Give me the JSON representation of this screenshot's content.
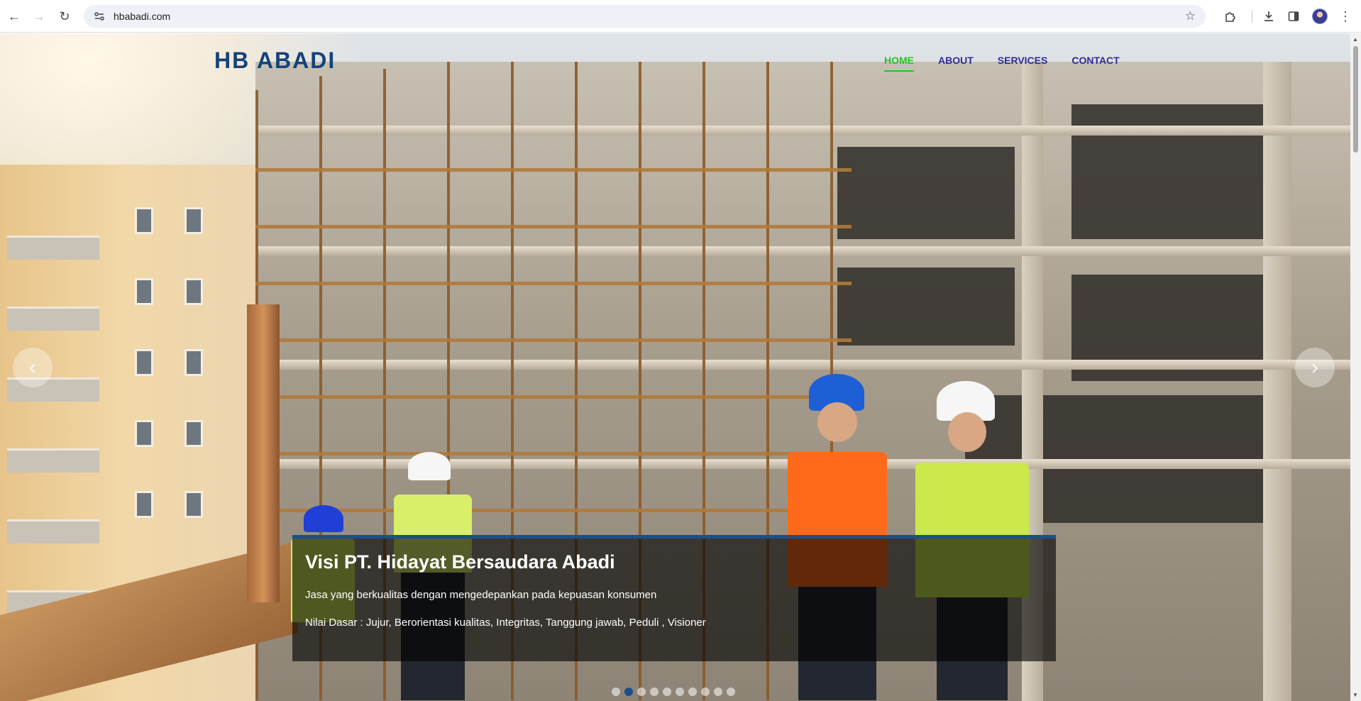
{
  "browser": {
    "url": "hbabadi.com",
    "icons": {
      "back": "back-arrow-icon",
      "forward": "forward-arrow-icon",
      "reload": "reload-icon",
      "site_info": "site-info-icon",
      "bookmark": "star-icon",
      "extensions": "puzzle-icon",
      "downloads": "download-icon",
      "side_panel": "side-panel-icon",
      "menu": "kebab-menu-icon"
    }
  },
  "site": {
    "logo": "HB ABADI",
    "nav": [
      {
        "label": "HOME",
        "active": true
      },
      {
        "label": "ABOUT",
        "active": false
      },
      {
        "label": "SERVICES",
        "active": false
      },
      {
        "label": "CONTACT",
        "active": false
      }
    ]
  },
  "carousel": {
    "prev_symbol": "‹",
    "next_symbol": "›",
    "caption": {
      "title": "Visi PT. Hidayat Bersaudara Abadi",
      "line1": "Jasa yang berkualitas dengan mengedepankan pada kepuasan konsumen",
      "line2": "Nilai Dasar : Jujur, Berorientasi kualitas, Integritas, Tanggung jawab, Peduli , Visioner"
    },
    "slide_count": 10,
    "active_slide": 2
  },
  "colors": {
    "logo": "#14427b",
    "nav_active": "#24c324",
    "nav_link": "#2c2c9a",
    "caption_border": "#1b4e8f"
  }
}
